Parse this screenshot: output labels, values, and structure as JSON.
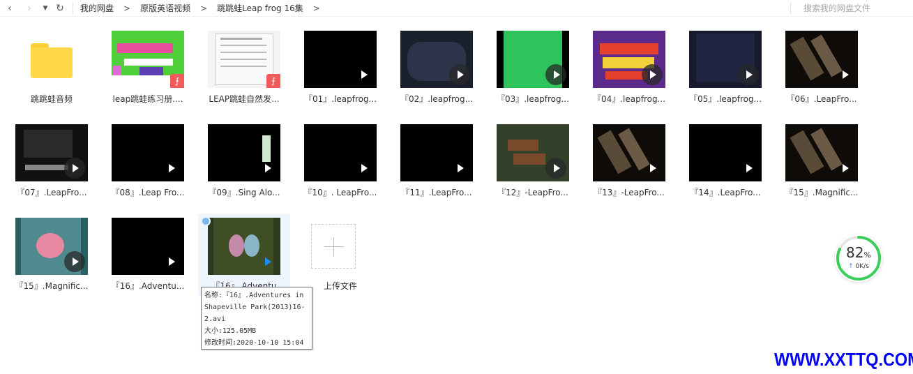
{
  "breadcrumb": [
    "我的网盘",
    "原版英语视频",
    "跳跳蛙Leap frog 16集"
  ],
  "search": {
    "placeholder": "搜索我的网盘文件"
  },
  "items": [
    {
      "label": "跳跳蛙音频",
      "type": "folder"
    },
    {
      "label": "leap跳蛙练习册....",
      "type": "pdf"
    },
    {
      "label": "LEAP跳蛙自然发...",
      "type": "pdf"
    },
    {
      "label": "『01』.leapfrog...",
      "type": "video"
    },
    {
      "label": "『02』.leapfrog...",
      "type": "video"
    },
    {
      "label": "『03』.leapfrog...",
      "type": "video"
    },
    {
      "label": "『04』.leapfrog...",
      "type": "video"
    },
    {
      "label": "『05』.leapfrog...",
      "type": "video"
    },
    {
      "label": "『06』.LeapFro...",
      "type": "video"
    },
    {
      "label": "『07』.LeapFro...",
      "type": "video"
    },
    {
      "label": "『08』.Leap Fro...",
      "type": "video"
    },
    {
      "label": "『09』.Sing Alo...",
      "type": "video"
    },
    {
      "label": "『10』. LeapFro...",
      "type": "video"
    },
    {
      "label": "『11』.LeapFro...",
      "type": "video"
    },
    {
      "label": "『12』-LeapFro...",
      "type": "video"
    },
    {
      "label": "『13』-LeapFro...",
      "type": "video"
    },
    {
      "label": "『14』.LeapFro...",
      "type": "video"
    },
    {
      "label": "『15』.Magnific...",
      "type": "video"
    },
    {
      "label": "『15』.Magnific...",
      "type": "video"
    },
    {
      "label": "『16』.Adventu...",
      "type": "video"
    },
    {
      "label": "『16』.Adventu",
      "type": "video"
    },
    {
      "label": "上传文件",
      "type": "upload"
    }
  ],
  "tooltip": {
    "name": "名称:『16』.Adventures in Shapeville Park(2013)16-2.avi",
    "size": "大小:125.05MB",
    "modified": "修改时间:2020-10-10 15:04"
  },
  "speed": {
    "percent": "82",
    "percent_unit": "%",
    "rate": "0K/s"
  },
  "watermark": "WWW.XXTTQ.COM",
  "colors": {
    "accent": "#1a8cff",
    "folder": "#ffd94a",
    "pdf": "#f25b5b",
    "ring": "#3ccd5a",
    "watermark": "#0000ff"
  }
}
